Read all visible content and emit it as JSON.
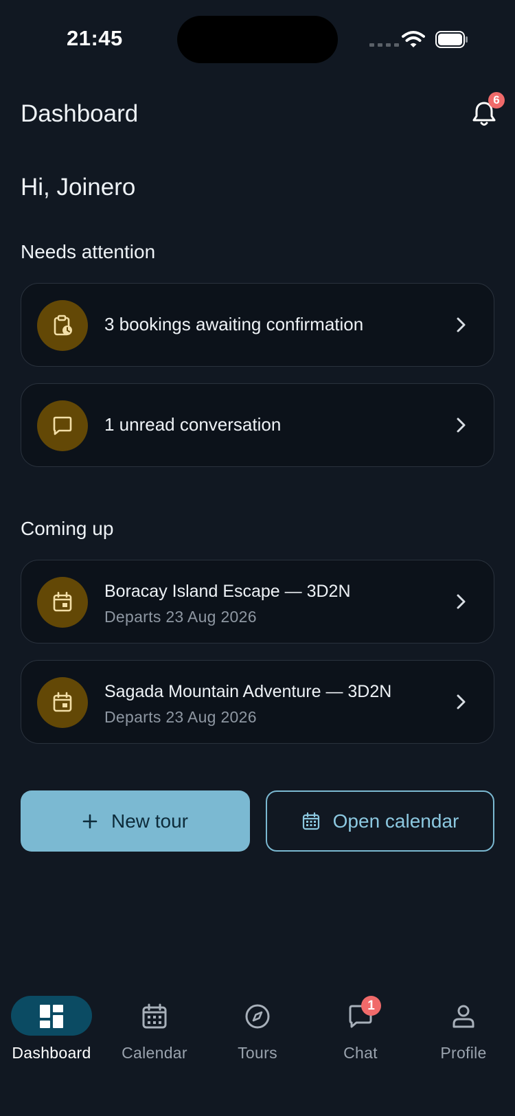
{
  "status": {
    "time": "21:45"
  },
  "header": {
    "title": "Dashboard",
    "notification_count": "6"
  },
  "greeting": "Hi, Joinero",
  "needs_attention": {
    "title": "Needs attention",
    "items": [
      {
        "label": "3 bookings awaiting confirmation",
        "icon": "clipboard-clock-icon"
      },
      {
        "label": "1 unread conversation",
        "icon": "chat-bubble-icon"
      }
    ]
  },
  "coming_up": {
    "title": "Coming up",
    "items": [
      {
        "title": "Boracay Island Escape — 3D2N",
        "subtitle": "Departs 23 Aug 2026",
        "icon": "calendar-icon"
      },
      {
        "title": "Sagada Mountain Adventure — 3D2N",
        "subtitle": "Departs 23 Aug 2026",
        "icon": "calendar-icon"
      }
    ]
  },
  "actions": {
    "new_tour": {
      "label": "New tour",
      "icon": "plus-icon"
    },
    "open_calendar": {
      "label": "Open calendar",
      "icon": "calendar-icon"
    }
  },
  "nav": {
    "items": [
      {
        "label": "Dashboard",
        "icon": "dashboard-icon",
        "active": true
      },
      {
        "label": "Calendar",
        "icon": "calendar-icon"
      },
      {
        "label": "Tours",
        "icon": "compass-icon"
      },
      {
        "label": "Chat",
        "icon": "chat-icon",
        "badge": "1"
      },
      {
        "label": "Profile",
        "icon": "profile-icon"
      }
    ]
  },
  "colors": {
    "background": "#111822",
    "card": "#0c121a",
    "accent": "#7bb9d2",
    "icon_circle": "#634806",
    "icon_stroke": "#f3dfa8",
    "badge": "#f06a6a",
    "nav_active": "#0b4b63"
  }
}
